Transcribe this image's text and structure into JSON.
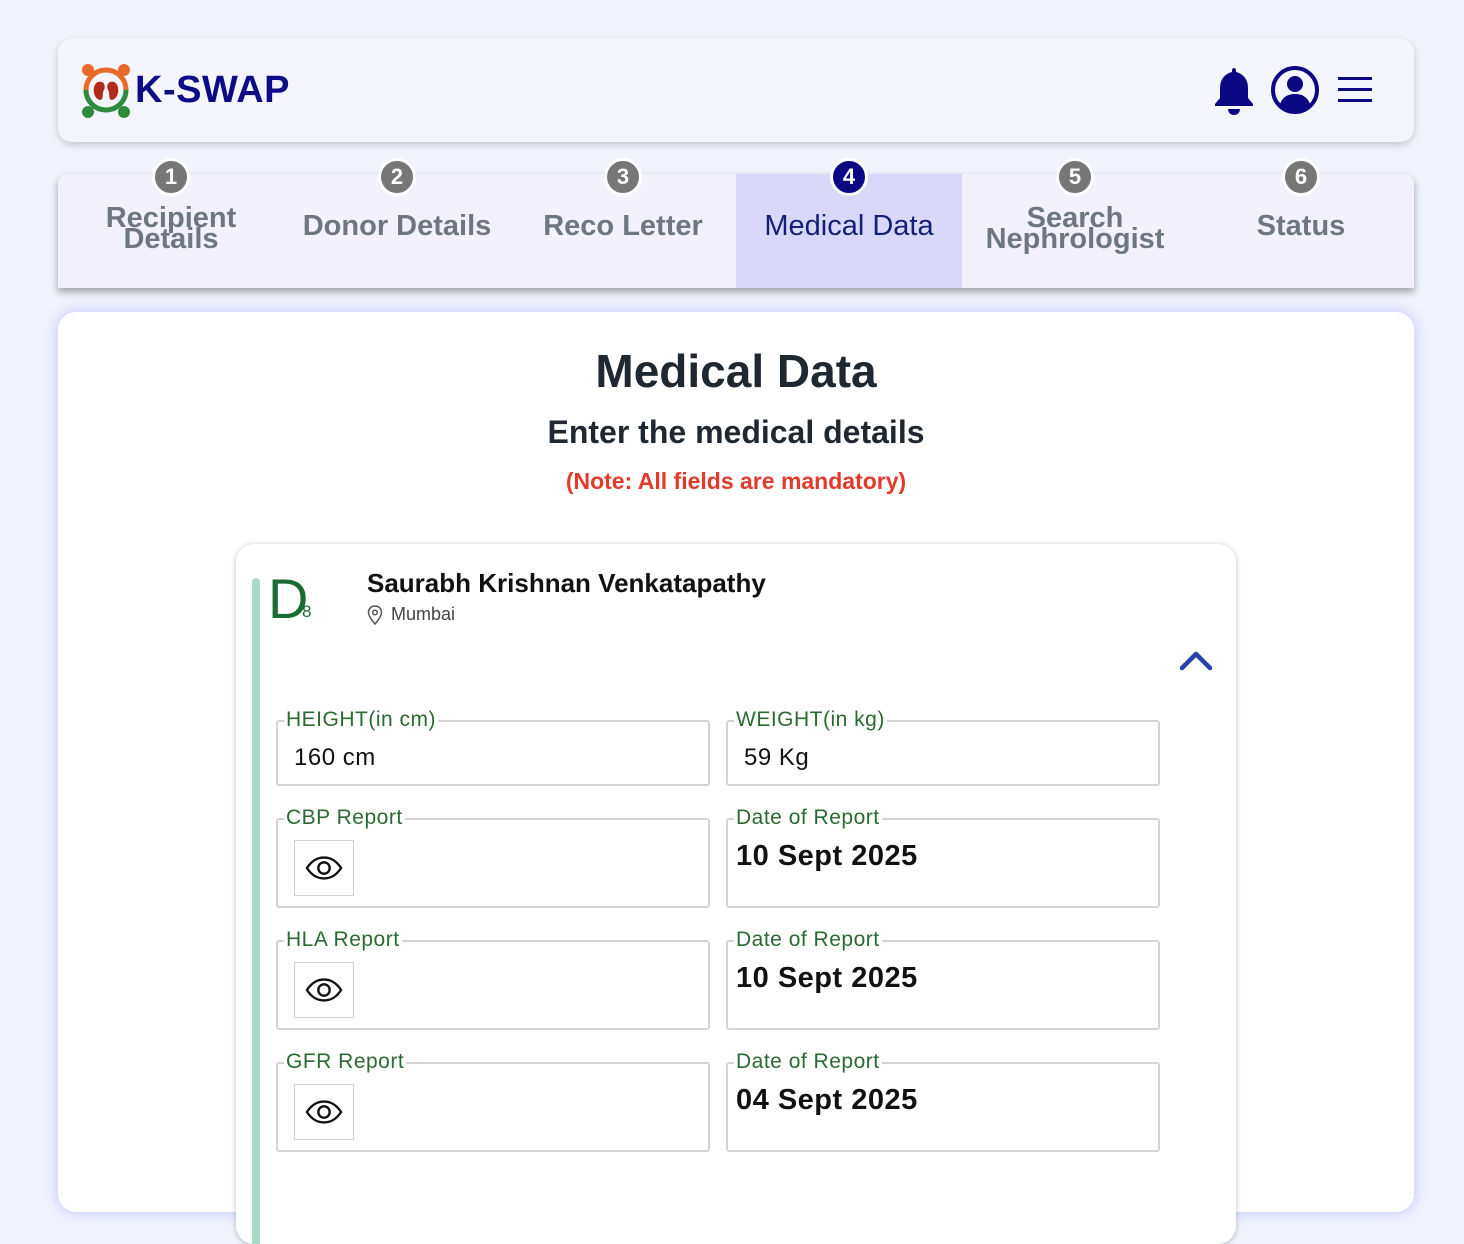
{
  "app": {
    "brand": "K-SWAP"
  },
  "header": {
    "icons": [
      "bell-icon",
      "user-circle-icon",
      "hamburger-menu-icon"
    ]
  },
  "steps": [
    {
      "num": "1",
      "label": "Recipient Details",
      "active": false
    },
    {
      "num": "2",
      "label": "Donor Details",
      "active": false
    },
    {
      "num": "3",
      "label": "Reco Letter",
      "active": false
    },
    {
      "num": "4",
      "label": "Medical Data",
      "active": true
    },
    {
      "num": "5",
      "label": "Search Nephrologist",
      "active": false
    },
    {
      "num": "6",
      "label": "Status",
      "active": false
    }
  ],
  "page": {
    "title": "Medical Data",
    "subtitle": "Enter the medical details",
    "note": "(Note: All fields are mandatory)"
  },
  "donor": {
    "badge_letter": "D",
    "badge_sub": "8",
    "name": "Saurabh Krishnan Venkatapathy",
    "location": "Mumbai"
  },
  "fields": {
    "height": {
      "label": "HEIGHT(in cm)",
      "value": "160 cm"
    },
    "weight": {
      "label": "WEIGHT(in kg)",
      "value": "59 Kg"
    },
    "cbp": {
      "label": "CBP Report",
      "date_label": "Date of Report",
      "date": "10 Sept 2025"
    },
    "hla": {
      "label": "HLA Report",
      "date_label": "Date of Report",
      "date": "10 Sept 2025"
    },
    "gfr": {
      "label": "GFR Report",
      "date_label": "Date of Report",
      "date": "04 Sept 2025"
    }
  },
  "colors": {
    "brand": "#0d0b86",
    "active_step_bg": "#d9d8fa",
    "note_red": "#e23a2b",
    "label_green": "#2b6a30",
    "donor_bar": "#a9dcc3"
  }
}
